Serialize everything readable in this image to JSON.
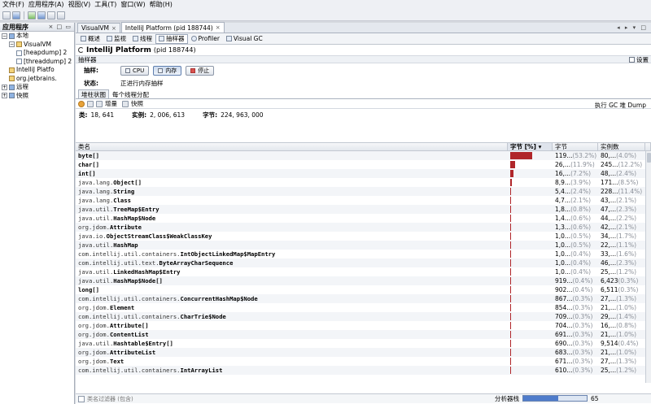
{
  "menu": [
    "文件(F)",
    "应用程序(A)",
    "视图(V)",
    "工具(T)",
    "窗口(W)",
    "帮助(H)"
  ],
  "left_panel": {
    "title": "应用程序",
    "controls": "× □ ▭",
    "nodes": [
      {
        "label": "本地",
        "level": 0,
        "toggle": "−",
        "icon": "host"
      },
      {
        "label": "VisualVM",
        "level": 1,
        "toggle": "−",
        "icon": "app"
      },
      {
        "label": "[heapdump] 2",
        "level": 2,
        "toggle": "",
        "icon": "doc"
      },
      {
        "label": "[threaddump] 2",
        "level": 2,
        "toggle": "",
        "icon": "doc"
      },
      {
        "label": "IntelliJ Platfo",
        "level": 1,
        "toggle": "",
        "icon": "app"
      },
      {
        "label": "org.jetbrains.",
        "level": 1,
        "toggle": "",
        "icon": "app"
      },
      {
        "label": "远程",
        "level": 0,
        "toggle": "+",
        "icon": "host"
      },
      {
        "label": "快照",
        "level": 0,
        "toggle": "+",
        "icon": "host"
      }
    ]
  },
  "doc_tabs": [
    {
      "label": "VisualVM",
      "active": false
    },
    {
      "label": "IntelliJ Platform (pid 188744)",
      "active": true
    }
  ],
  "doc_controls": "◂ ▸ ▾ □",
  "sub_tabs": [
    {
      "label": "概述",
      "icon": "overview-icon",
      "active": false
    },
    {
      "label": "监视",
      "icon": "monitor-icon",
      "active": false
    },
    {
      "label": "线程",
      "icon": "threads-icon",
      "active": false
    },
    {
      "label": "抽样器",
      "icon": "sampler-icon",
      "active": true
    },
    {
      "label": "Profiler",
      "icon": "profiler-icon",
      "active": false
    },
    {
      "label": "Visual GC",
      "icon": "visualgc-icon",
      "active": false
    }
  ],
  "page_title": "IntelliJ Platform",
  "page_title_pid": "(pid 188744)",
  "sampler_label": "抽样器",
  "settings_label": "设置",
  "sample_label": "抽样:",
  "buttons": {
    "cpu": "CPU",
    "memory": "内存",
    "stop": "停止"
  },
  "status_label": "状态:",
  "status_value": "正进行内存抽样",
  "view_tabs": [
    {
      "label": "堆柱状图",
      "active": true
    },
    {
      "label": "每个线程分配",
      "active": false
    }
  ],
  "result_bar": {
    "delta": "增量",
    "snapshot": "快照",
    "right": "执行 GC  堆 Dump"
  },
  "stats": {
    "classes_label": "类:",
    "classes_value": "18, 641",
    "instances_label": "实例:",
    "instances_value": "2, 006, 613",
    "bytes_label": "字节:",
    "bytes_value": "224, 963, 000"
  },
  "table": {
    "headers": {
      "name": "类名",
      "bar": "字节 [%] ▾",
      "bytes": "字节",
      "instances": "实例数"
    },
    "rows": [
      {
        "pkg": "",
        "cls": "byte[]",
        "pct": 53.2,
        "bytes": "119...",
        "bytes_pct": "(53.2%)",
        "inst": "80,...",
        "inst_pct": "(4.0%)"
      },
      {
        "pkg": "",
        "cls": "char[]",
        "pct": 11.9,
        "bytes": "26,...",
        "bytes_pct": "(11.9%)",
        "inst": "245...",
        "inst_pct": "(12.2%)"
      },
      {
        "pkg": "",
        "cls": "int[]",
        "pct": 7.2,
        "bytes": "16,...",
        "bytes_pct": "(7.2%)",
        "inst": "48,...",
        "inst_pct": "(2.4%)"
      },
      {
        "pkg": "java.lang.",
        "cls": "Object[]",
        "pct": 3.9,
        "bytes": "8,9...",
        "bytes_pct": "(3.9%)",
        "inst": "171...",
        "inst_pct": "(8.5%)"
      },
      {
        "pkg": "java.lang.",
        "cls": "String",
        "pct": 2.4,
        "bytes": "5,4...",
        "bytes_pct": "(2.4%)",
        "inst": "228...",
        "inst_pct": "(11.4%)"
      },
      {
        "pkg": "java.lang.",
        "cls": "Class",
        "pct": 2.1,
        "bytes": "4,7...",
        "bytes_pct": "(2.1%)",
        "inst": "43,...",
        "inst_pct": "(2.1%)"
      },
      {
        "pkg": "java.util.",
        "cls": "TreeMap$Entry",
        "pct": 0.8,
        "bytes": "1,8...",
        "bytes_pct": "(0.8%)",
        "inst": "47,...",
        "inst_pct": "(2.3%)"
      },
      {
        "pkg": "java.util.",
        "cls": "HashMap$Node",
        "pct": 0.6,
        "bytes": "1,4...",
        "bytes_pct": "(0.6%)",
        "inst": "44,...",
        "inst_pct": "(2.2%)"
      },
      {
        "pkg": "org.jdom.",
        "cls": "Attribute",
        "pct": 0.6,
        "bytes": "1,3...",
        "bytes_pct": "(0.6%)",
        "inst": "42,...",
        "inst_pct": "(2.1%)"
      },
      {
        "pkg": "java.io.",
        "cls": "ObjectStreamClass$WeakClassKey",
        "pct": 0.5,
        "bytes": "1,0...",
        "bytes_pct": "(0.5%)",
        "inst": "34,...",
        "inst_pct": "(1.7%)"
      },
      {
        "pkg": "java.util.",
        "cls": "HashMap",
        "pct": 0.5,
        "bytes": "1,0...",
        "bytes_pct": "(0.5%)",
        "inst": "22,...",
        "inst_pct": "(1.1%)"
      },
      {
        "pkg": "com.intellij.util.containers.",
        "cls": "IntObjectLinkedMap$MapEntry",
        "pct": 0.4,
        "bytes": "1,0...",
        "bytes_pct": "(0.4%)",
        "inst": "33,...",
        "inst_pct": "(1.6%)"
      },
      {
        "pkg": "com.intellij.util.text.",
        "cls": "ByteArrayCharSequence",
        "pct": 0.4,
        "bytes": "1,0...",
        "bytes_pct": "(0.4%)",
        "inst": "46,...",
        "inst_pct": "(2.3%)"
      },
      {
        "pkg": "java.util.",
        "cls": "LinkedHashMap$Entry",
        "pct": 0.4,
        "bytes": "1,0...",
        "bytes_pct": "(0.4%)",
        "inst": "25,...",
        "inst_pct": "(1.2%)"
      },
      {
        "pkg": "java.util.",
        "cls": "HashMap$Node[]",
        "pct": 0.4,
        "bytes": "919...",
        "bytes_pct": "(0.4%)",
        "inst": "6,423",
        "inst_pct": "(0.3%)"
      },
      {
        "pkg": "",
        "cls": "long[]",
        "pct": 0.4,
        "bytes": "902...",
        "bytes_pct": "(0.4%)",
        "inst": "6,511",
        "inst_pct": "(0.3%)"
      },
      {
        "pkg": "com.intellij.util.containers.",
        "cls": "ConcurrentHashMap$Node",
        "pct": 0.3,
        "bytes": "867...",
        "bytes_pct": "(0.3%)",
        "inst": "27,...",
        "inst_pct": "(1.3%)"
      },
      {
        "pkg": "org.jdom.",
        "cls": "Element",
        "pct": 0.3,
        "bytes": "854...",
        "bytes_pct": "(0.3%)",
        "inst": "21,...",
        "inst_pct": "(1.0%)"
      },
      {
        "pkg": "com.intellij.util.containers.",
        "cls": "CharTrie$Node",
        "pct": 0.3,
        "bytes": "709...",
        "bytes_pct": "(0.3%)",
        "inst": "29,...",
        "inst_pct": "(1.4%)"
      },
      {
        "pkg": "org.jdom.",
        "cls": "Attribute[]",
        "pct": 0.3,
        "bytes": "704...",
        "bytes_pct": "(0.3%)",
        "inst": "16,...",
        "inst_pct": "(0.8%)"
      },
      {
        "pkg": "org.jdom.",
        "cls": "ContentList",
        "pct": 0.3,
        "bytes": "691...",
        "bytes_pct": "(0.3%)",
        "inst": "21,...",
        "inst_pct": "(1.0%)"
      },
      {
        "pkg": "java.util.",
        "cls": "Hashtable$Entry[]",
        "pct": 0.3,
        "bytes": "690...",
        "bytes_pct": "(0.3%)",
        "inst": "9,514",
        "inst_pct": "(0.4%)"
      },
      {
        "pkg": "org.jdom.",
        "cls": "AttributeList",
        "pct": 0.3,
        "bytes": "683...",
        "bytes_pct": "(0.3%)",
        "inst": "21,...",
        "inst_pct": "(1.0%)"
      },
      {
        "pkg": "org.jdom.",
        "cls": "Text",
        "pct": 0.3,
        "bytes": "671...",
        "bytes_pct": "(0.3%)",
        "inst": "27,...",
        "inst_pct": "(1.3%)"
      },
      {
        "pkg": "com.intellij.util.containers.",
        "cls": "IntArrayList",
        "pct": 0.3,
        "bytes": "610...",
        "bytes_pct": "(0.3%)",
        "inst": "25,...",
        "inst_pct": "(1.2%)"
      }
    ]
  },
  "filter_placeholder": "类名过滤器 (包含)",
  "status_bar": {
    "label": "分析器栈",
    "progress": 0.55,
    "progress_text": "65"
  }
}
